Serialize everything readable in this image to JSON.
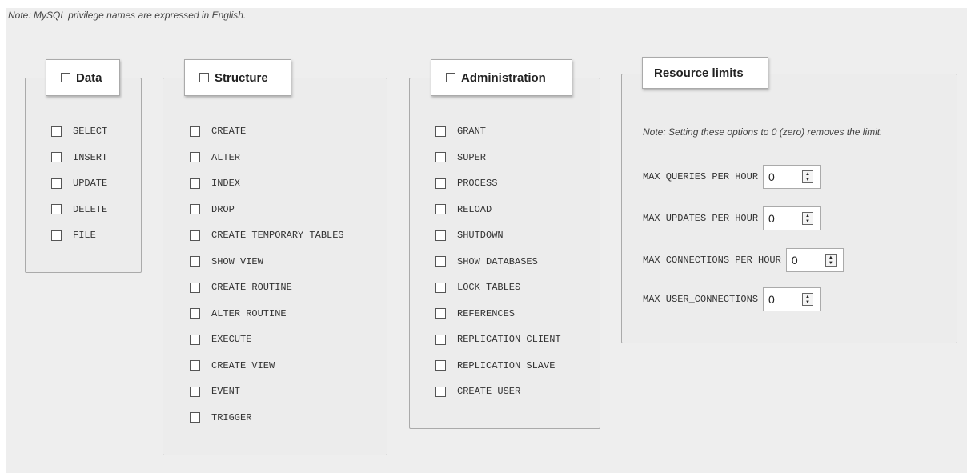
{
  "note": "Note: MySQL privilege names are expressed in English.",
  "groups": {
    "data": {
      "legend": "Data",
      "items": [
        "SELECT",
        "INSERT",
        "UPDATE",
        "DELETE",
        "FILE"
      ]
    },
    "structure": {
      "legend": "Structure",
      "items": [
        "CREATE",
        "ALTER",
        "INDEX",
        "DROP",
        "CREATE TEMPORARY TABLES",
        "SHOW VIEW",
        "CREATE ROUTINE",
        "ALTER ROUTINE",
        "EXECUTE",
        "CREATE VIEW",
        "EVENT",
        "TRIGGER"
      ]
    },
    "administration": {
      "legend": "Administration",
      "items": [
        "GRANT",
        "SUPER",
        "PROCESS",
        "RELOAD",
        "SHUTDOWN",
        "SHOW DATABASES",
        "LOCK TABLES",
        "REFERENCES",
        "REPLICATION CLIENT",
        "REPLICATION SLAVE",
        "CREATE USER"
      ]
    }
  },
  "resource_limits": {
    "legend": "Resource limits",
    "note": "Note: Setting these options to 0 (zero) removes the limit.",
    "fields": [
      {
        "label": "MAX QUERIES PER HOUR",
        "value": "0"
      },
      {
        "label": "MAX UPDATES PER HOUR",
        "value": "0"
      },
      {
        "label": "MAX CONNECTIONS PER HOUR",
        "value": "0"
      },
      {
        "label": "MAX USER_CONNECTIONS",
        "value": "0"
      }
    ]
  },
  "icons": {
    "checkbox": "checkbox-icon",
    "spinner": "spinner-arrows-icon"
  }
}
